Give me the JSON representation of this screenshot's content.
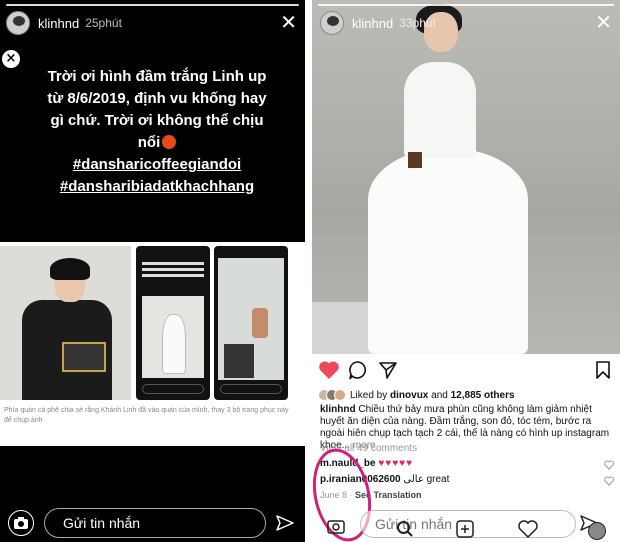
{
  "left_story": {
    "username": "klinhnd",
    "time": "25phút",
    "caption_lines": [
      "Trời ơi hình đầm trắng Linh up",
      "từ 8/6/2019, định vu khống hay",
      "gì chứ. Trời ơi không thể chịu",
      "nổi"
    ],
    "hashtags": [
      "#dansharicoffeegiandoi",
      "#dansharibiadatkhachhang"
    ],
    "collage_caption": "Phía quán cà phê chia sẻ rằng Khánh Linh đã vào quán của mình, thay 3 bộ trang phục này để chụp ảnh",
    "message_placeholder": "Gửi tin nhắn"
  },
  "right_post": {
    "username": "klinhnd",
    "time": "33phút",
    "liked_by_prefix": "Liked by ",
    "liked_by_user": "dinovux",
    "liked_by_and": " and ",
    "liked_by_count": "12,885 others",
    "caption_user": "klinhnd",
    "caption_text": " Chiều thứ bảy mưa phùn cũng không làm giảm nhiệt huyết ăn diện của nàng. Đầm trắng, son đỏ, tóc tém, bước ra ngoài hiên chụp tạch tạch 2 cái, thế là nàng có hình up instagram khoe...",
    "caption_more": " more",
    "view_all": "View all 49 comments",
    "comment1_user": "m.nauld_be",
    "comment1_text": "♥♥♥♥♥",
    "comment2_user": "p.iranian0062600",
    "comment2_text": " عالی  great",
    "date": "June 8 · ",
    "see_translation": "See Translation",
    "message_placeholder": "Gửi tin nhắn"
  },
  "colors": {
    "heart_red": "#ed4956",
    "marker_pink": "#d21e7c"
  }
}
